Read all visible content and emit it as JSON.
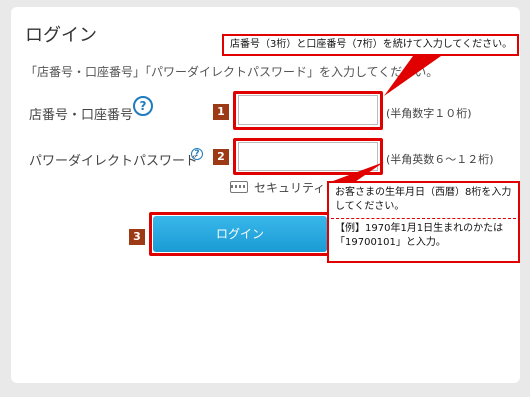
{
  "page": {
    "title": "ログイン",
    "lead": "「店番号・口座番号」「パワーダイレクトパスワード」を入力してください。"
  },
  "fields": [
    {
      "label": "店番号・口座番号",
      "help_icon": "question-circle-icon",
      "badge": "1",
      "value": "",
      "hint": "(半角数字１０桁)"
    },
    {
      "label": "パワーダイレクトパスワード",
      "help_icon": "question-circle-icon",
      "badge": "2",
      "value": "",
      "hint": "(半角英数６～１２桁)"
    }
  ],
  "security_link": {
    "icon": "keyboard-icon",
    "label": "セキュリティ"
  },
  "login_button": {
    "badge": "3",
    "label": "ログイン"
  },
  "annotations": {
    "top": "店番号（3桁）と口座番号（7桁）を続けて入力してください。",
    "right_line1": "お客さまの生年月日（西暦）8桁を入力してください。",
    "right_line2": "【例】1970年1月1日生まれのかたは「19700101」と入力。"
  },
  "colors": {
    "accent_red": "#e10000",
    "badge_brown": "#9d3a16",
    "button_blue": "#1a9bd4",
    "help_blue": "#1f7bc0"
  }
}
